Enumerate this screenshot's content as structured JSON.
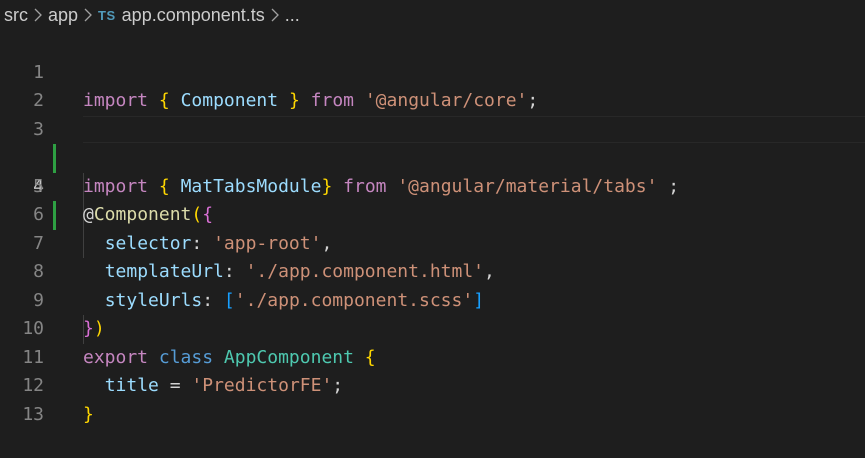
{
  "breadcrumb": {
    "segments": [
      "src",
      "app",
      "app.component.ts",
      "..."
    ],
    "file_badge": "TS"
  },
  "editor": {
    "active_line": 4,
    "modified_lines": [
      3,
      4
    ],
    "line_numbers": [
      "1",
      "2",
      "3",
      "4",
      "5",
      "6",
      "7",
      "8",
      "9",
      "10",
      "11",
      "12",
      "13"
    ],
    "code": {
      "l1": {
        "import": "import",
        "ob": "{",
        "name": "Component",
        "cb": "}",
        "from": "from",
        "module": "'@angular/core'",
        "semi": ";"
      },
      "l3": {
        "import": "import",
        "ob": "{",
        "name": "MatTabsModule",
        "cb": "}",
        "from": "from",
        "module": "'@angular/material/tabs'",
        "semi": ";"
      },
      "l5": {
        "at": "@",
        "decorator": "Component",
        "op": "(",
        "ob": "{"
      },
      "l6": {
        "key": "selector",
        "colon": ":",
        "value": "'app-root'",
        "comma": ","
      },
      "l7": {
        "key": "templateUrl",
        "colon": ":",
        "value": "'./app.component.html'",
        "comma": ","
      },
      "l8": {
        "key": "styleUrls",
        "colon": ":",
        "obr": "[",
        "value": "'./app.component.scss'",
        "cbr": "]"
      },
      "l9": {
        "cb": "}",
        "cp": ")"
      },
      "l10": {
        "export": "export",
        "class": "class",
        "name": "AppComponent",
        "ob": "{"
      },
      "l11": {
        "key": "title",
        "eq": "=",
        "value": "'PredictorFE'",
        "semi": ";"
      },
      "l12": {
        "cb": "}"
      }
    }
  },
  "colors": {
    "background": "#1e1e1e",
    "keyword_control": "#c586c0",
    "keyword_declaration": "#569cd6",
    "variable": "#9cdcfe",
    "type": "#4ec9b0",
    "string": "#ce9178",
    "function": "#dcdcaa",
    "bracket_level1": "#ffd700",
    "bracket_level2": "#da70d6",
    "bracket_level3": "#179fff",
    "gutter_modified": "#2ea043"
  }
}
